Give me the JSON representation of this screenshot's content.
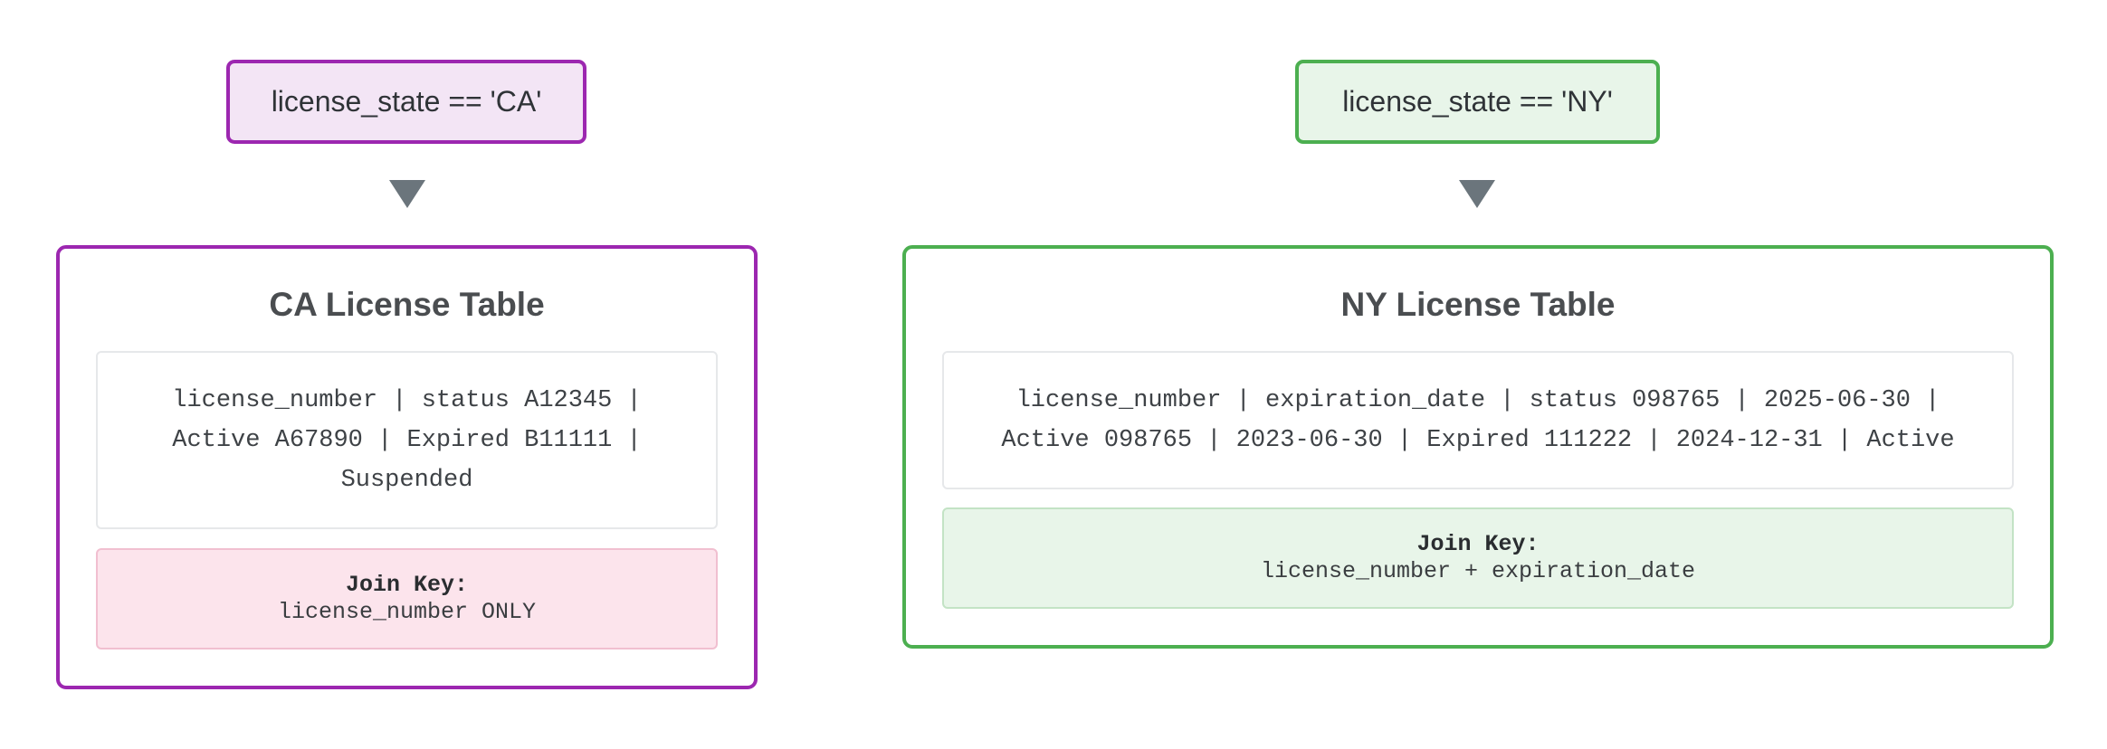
{
  "ca": {
    "condition": "license_state == 'CA'",
    "title": "CA License Table",
    "rows_lines": [
      "license_number | status A12345 |",
      "Active A67890 | Expired B11111 |",
      "Suspended"
    ],
    "join_key_label": "Join Key:",
    "join_key_value": "license_number ONLY",
    "colors": {
      "border": "#9c27b0",
      "fill": "#f3e5f5",
      "key_fill": "#fce4ec"
    }
  },
  "ny": {
    "condition": "license_state == 'NY'",
    "title": "NY License Table",
    "rows_lines": [
      "license_number | expiration_date | status 098765 | 2025-06-30 |",
      "Active 098765 | 2023-06-30 | Expired 111222 | 2024-12-31 | Active"
    ],
    "join_key_label": "Join Key:",
    "join_key_value": "license_number + expiration_date",
    "colors": {
      "border": "#4caf50",
      "fill": "#e8f5e9",
      "key_fill": "#e8f5e9"
    }
  },
  "arrow_icon": "down-triangle-icon"
}
